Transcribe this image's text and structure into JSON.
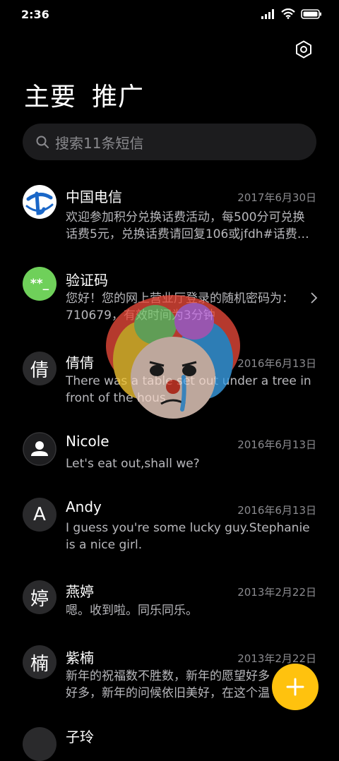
{
  "status_bar": {
    "time": "2:36"
  },
  "tabs": [
    {
      "label": "主要"
    },
    {
      "label": "推广"
    }
  ],
  "search": {
    "placeholder": "搜索11条短信"
  },
  "conversations": [
    {
      "name": "中国电信",
      "date": "2017年6月30日",
      "preview": "欢迎参加积分兑换话费活动，每500分可兑换话费5元，兑换话费请回复106或jfdh#话费…",
      "avatar": "telecom-logo"
    },
    {
      "name": "验证码",
      "date": "",
      "preview": "您好！您的网上营业厅登录的随机密码为：710679，有效时间为3分钟",
      "avatar_text": "**_"
    },
    {
      "name": "倩倩",
      "date": "2016年6月13日",
      "preview": "There was a table set out under a tree in front of the hous",
      "avatar_text": "倩"
    },
    {
      "name": "Nicole",
      "date": "2016年6月13日",
      "preview": "Let's eat out,shall we?",
      "avatar": "person-icon"
    },
    {
      "name": "Andy",
      "date": "2016年6月13日",
      "preview": "I guess you're some lucky guy.Stephanie is a nice girl.",
      "avatar_text": "A"
    },
    {
      "name": "燕婷",
      "date": "2013年2月22日",
      "preview": "嗯。收到啦。同乐同乐。",
      "avatar_text": "婷"
    },
    {
      "name": "紫楠",
      "date": "2013年2月22日",
      "preview": "新年的祝福数不胜数，新年的愿望好多好多，新年的问候依旧美好，在这个温馨的时刻",
      "avatar_text": "楠"
    },
    {
      "name": "子玲",
      "date": "",
      "preview": "",
      "avatar_text": ""
    }
  ],
  "colors": {
    "accent": "#ffc20e",
    "verify_avatar": "#6fd05a",
    "telecom_blue": "#1a67c8"
  }
}
